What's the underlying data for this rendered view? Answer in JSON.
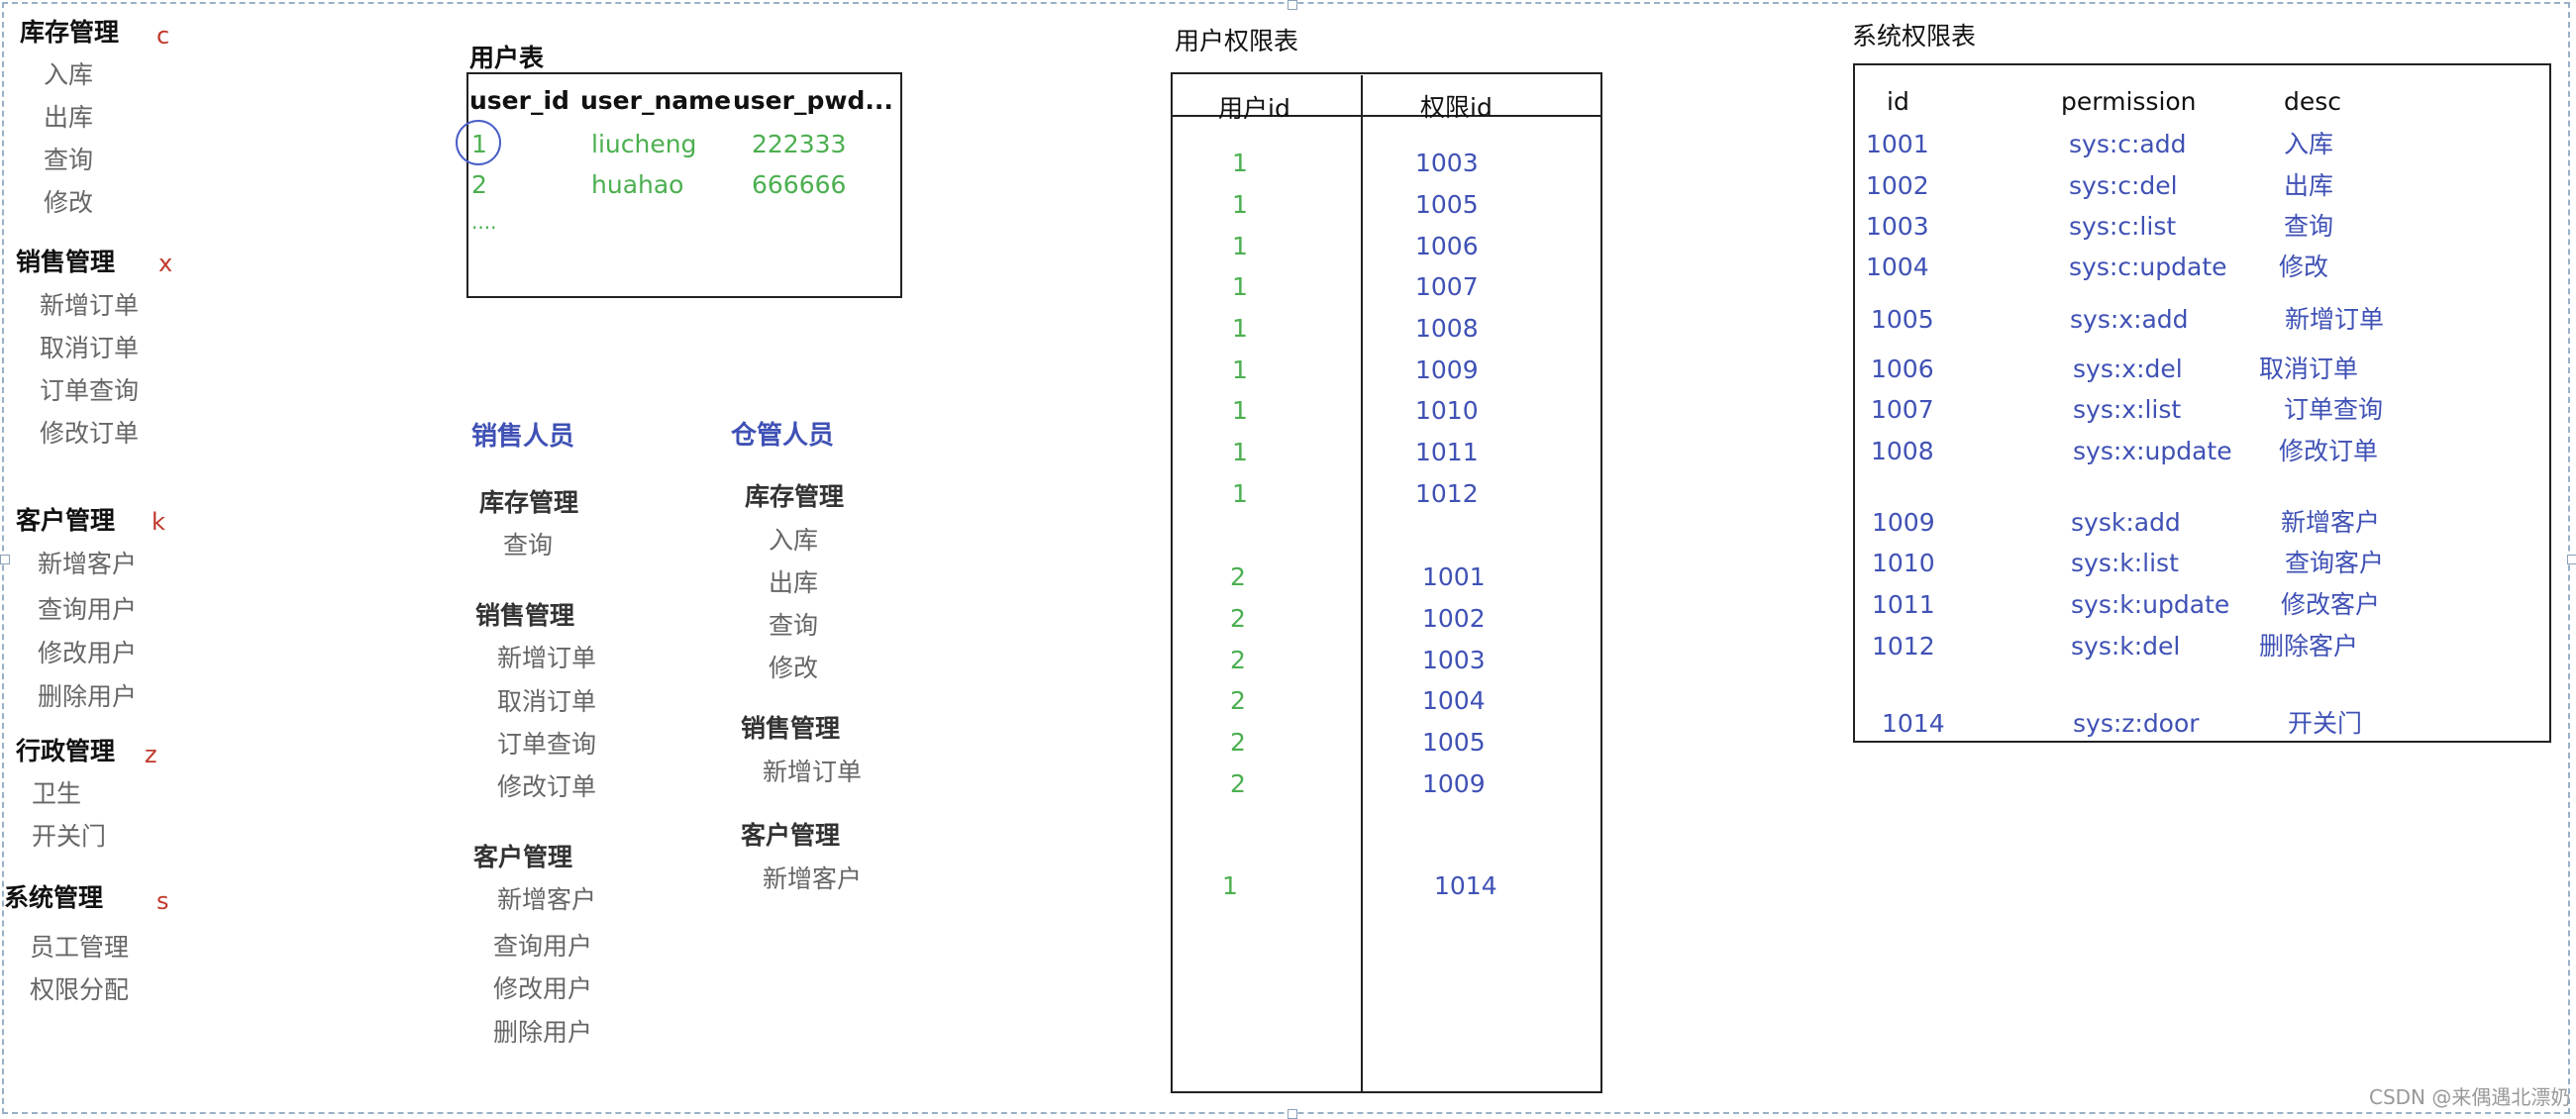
{
  "menu": [
    {
      "title": "库存管理",
      "letter": "c",
      "items": [
        "入库",
        "出库",
        "查询",
        "修改"
      ]
    },
    {
      "title": "销售管理",
      "letter": "x",
      "items": [
        "新增订单",
        "取消订单",
        "订单查询",
        "修改订单"
      ]
    },
    {
      "title": "客户管理",
      "letter": "k",
      "items": [
        "新增客户",
        "查询用户",
        "修改用户",
        "删除用户"
      ]
    },
    {
      "title": "行政管理",
      "letter": "z",
      "items": [
        "卫生",
        "开关门"
      ]
    },
    {
      "title": "系统管理",
      "letter": "s",
      "items": [
        "员工管理",
        "权限分配"
      ]
    }
  ],
  "user_table": {
    "title": "用户表",
    "headers": [
      "user_id",
      "user_name",
      "user_pwd..."
    ],
    "rows": [
      [
        "1",
        "liucheng",
        "222333"
      ],
      [
        "2",
        "huahao",
        "666666"
      ]
    ],
    "ellipsis": "...."
  },
  "sales_role": {
    "title": "销售人员",
    "groups": [
      {
        "title": "库存管理",
        "items": [
          "查询"
        ]
      },
      {
        "title": "销售管理",
        "items": [
          "新增订单",
          "取消订单",
          "订单查询",
          "修改订单"
        ]
      },
      {
        "title": "客户管理",
        "items": [
          "新增客户",
          "查询用户",
          "修改用户",
          "删除用户"
        ]
      }
    ]
  },
  "warehouse_role": {
    "title": "仓管人员",
    "groups": [
      {
        "title": "库存管理",
        "items": [
          "入库",
          "出库",
          "查询",
          "修改"
        ]
      },
      {
        "title": "销售管理",
        "items": [
          "新增订单"
        ]
      },
      {
        "title": "客户管理",
        "items": [
          "新增客户"
        ]
      }
    ]
  },
  "user_perm_table": {
    "title": "用户权限表",
    "headers": [
      "用户id",
      "权限id"
    ],
    "rows": [
      [
        "1",
        "1003"
      ],
      [
        "1",
        "1005"
      ],
      [
        "1",
        "1006"
      ],
      [
        "1",
        "1007"
      ],
      [
        "1",
        "1008"
      ],
      [
        "1",
        "1009"
      ],
      [
        "1",
        "1010"
      ],
      [
        "1",
        "1011"
      ],
      [
        "1",
        "1012"
      ],
      [
        "2",
        "1001"
      ],
      [
        "2",
        "1002"
      ],
      [
        "2",
        "1003"
      ],
      [
        "2",
        "1004"
      ],
      [
        "2",
        "1005"
      ],
      [
        "2",
        "1009"
      ],
      [
        "1",
        "1014"
      ]
    ]
  },
  "perm_table": {
    "title": "系统权限表",
    "headers": [
      "id",
      "permission",
      "desc"
    ],
    "rows": [
      [
        "1001",
        "sys:c:add",
        "入库"
      ],
      [
        "1002",
        "sys:c:del",
        "出库"
      ],
      [
        "1003",
        "sys:c:list",
        "查询"
      ],
      [
        "1004",
        "sys:c:update",
        "修改"
      ],
      [
        "1005",
        "sys:x:add",
        "新增订单"
      ],
      [
        "1006",
        "sys:x:del",
        "取消订单"
      ],
      [
        "1007",
        "sys:x:list",
        "订单查询"
      ],
      [
        "1008",
        "sys:x:update",
        "修改订单"
      ],
      [
        "1009",
        "sysk:add",
        "新增客户"
      ],
      [
        "1010",
        "sys:k:list",
        "查询客户"
      ],
      [
        "1011",
        "sys:k:update",
        "修改客户"
      ],
      [
        "1012",
        "sys:k:del",
        "删除客户"
      ],
      [
        "1014",
        "sys:z:door",
        "开关门"
      ]
    ]
  },
  "watermark": "CSDN @来偶遇北漂奶"
}
